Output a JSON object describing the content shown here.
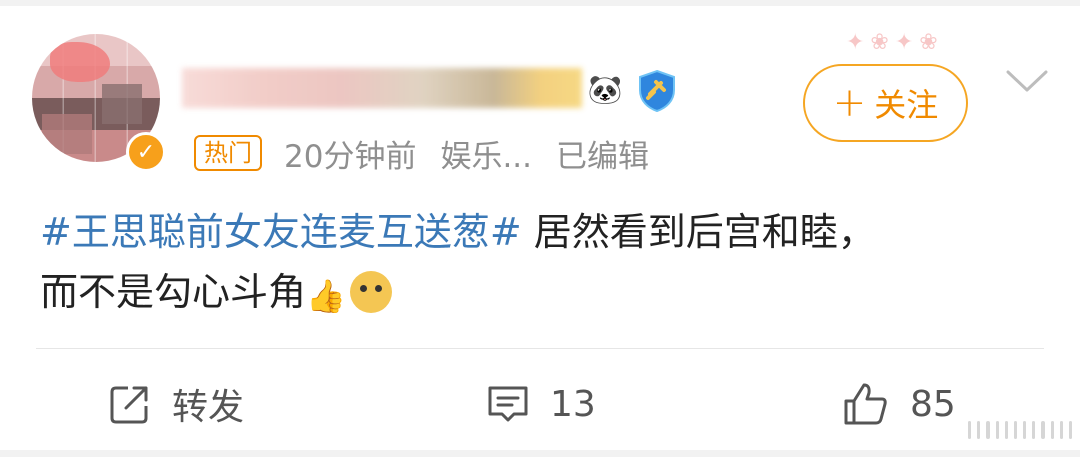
{
  "post": {
    "follow_label": "+关注",
    "follow_plus": "+",
    "follow_text": "关注",
    "hot_tag": "热门",
    "time": "20分钟前",
    "category": "娱乐...",
    "edited": "已编辑",
    "hashtag": "#王思聪前女友连麦互送葱#",
    "body_line1": " 居然看到后宫和睦，",
    "body_line2": "而不是勾心斗角",
    "emoji_thumb": "👍",
    "emoji_doge_name": "doge-emoji"
  },
  "actions": {
    "repost_label": "转发",
    "comment_count": "13",
    "like_count": "85"
  },
  "icons": {
    "verified": "verified-badge-icon",
    "panda": "panda-badge-icon",
    "shield": "shield-badge-icon",
    "chevron": "chevron-down-icon",
    "repost": "repost-icon",
    "comment": "comment-icon",
    "like": "thumbs-up-icon"
  },
  "colors": {
    "accent": "#f08a00",
    "hashtag": "#3b79b7",
    "text": "#222222",
    "meta": "#8f8f8f"
  }
}
